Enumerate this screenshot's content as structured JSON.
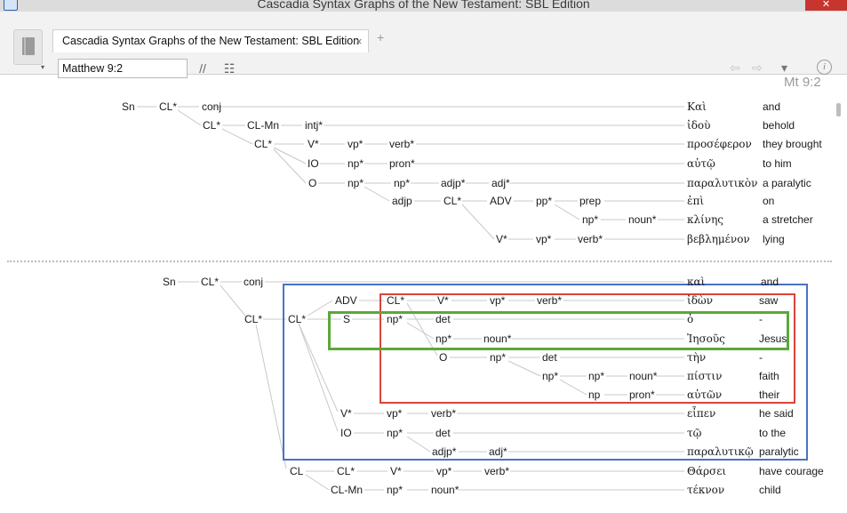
{
  "window": {
    "title": "Cascadia Syntax Graphs of the New Testament: SBL Edition",
    "close_glyph": "✕"
  },
  "tab": {
    "label": "Cascadia Syntax Graphs of the New Testament: SBL Edition",
    "close_glyph": "×",
    "add_glyph": "+"
  },
  "toolbar": {
    "reference_value": "Matthew 9:2",
    "parallel_glyph": "//",
    "list_glyph": "☷",
    "back_glyph": "⇦",
    "forward_glyph": "⇨",
    "dropdown_glyph": "▾",
    "info_glyph": "i",
    "book_caret": "▾"
  },
  "verse_ref": "Mt 9:2",
  "highlight_colors": {
    "blue": "#4a72c4",
    "red": "#d9443a",
    "green": "#5ba83a"
  },
  "graph": {
    "nodes": [
      "Sn",
      "CL*",
      "conj",
      "CL*",
      "CL-Mn",
      "intj*",
      "CL*",
      "V*",
      "vp*",
      "verb*",
      "IO",
      "np*",
      "pron*",
      "O",
      "np*",
      "np*",
      "adjp*",
      "adj*",
      "adjp",
      "CL*",
      "ADV",
      "pp*",
      "prep",
      "np*",
      "noun*",
      "V*",
      "vp*",
      "verb*",
      "Sn",
      "CL*",
      "conj",
      "CL*",
      "CL*",
      "ADV",
      "CL*",
      "V*",
      "vp*",
      "verb*",
      "S",
      "np*",
      "det",
      "np*",
      "noun*",
      "O",
      "np*",
      "det",
      "np*",
      "np*",
      "noun*",
      "np",
      "pron*",
      "V*",
      "vp*",
      "verb*",
      "IO",
      "np*",
      "det",
      "adjp*",
      "adj*",
      "CL",
      "CL*",
      "V*",
      "vp*",
      "verb*",
      "CL-Mn",
      "np*",
      "noun*"
    ],
    "words": [
      {
        "greek": "Καὶ",
        "gloss": "and"
      },
      {
        "greek": "ἰδοὺ",
        "gloss": "behold"
      },
      {
        "greek": "προσέφερον",
        "gloss": "they brought"
      },
      {
        "greek": "αὐτῷ",
        "gloss": "to him"
      },
      {
        "greek": "παραλυτικὸν",
        "gloss": "a paralytic"
      },
      {
        "greek": "ἐπὶ",
        "gloss": "on"
      },
      {
        "greek": "κλίνης",
        "gloss": "a stretcher"
      },
      {
        "greek": "βεβλημένον",
        "gloss": "lying"
      },
      {
        "greek": "καὶ",
        "gloss": "and"
      },
      {
        "greek": "ἰδὼν",
        "gloss": "saw"
      },
      {
        "greek": "ὁ",
        "gloss": "-"
      },
      {
        "greek": "Ἰησοῦς",
        "gloss": "Jesus"
      },
      {
        "greek": "τὴν",
        "gloss": "-"
      },
      {
        "greek": "πίστιν",
        "gloss": "faith"
      },
      {
        "greek": "αὐτῶν",
        "gloss": "their"
      },
      {
        "greek": "εἶπεν",
        "gloss": "he said"
      },
      {
        "greek": "τῷ",
        "gloss": "to the"
      },
      {
        "greek": "παραλυτικῷ",
        "gloss": "paralytic"
      },
      {
        "greek": "Θάρσει",
        "gloss": "have courage"
      },
      {
        "greek": "τέκνον",
        "gloss": "child"
      }
    ]
  }
}
